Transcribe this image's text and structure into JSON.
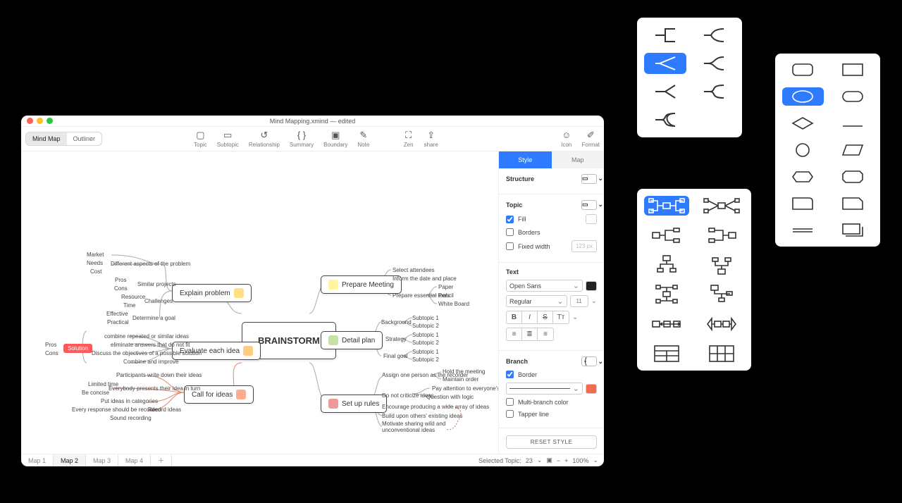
{
  "title": "Mind Mapping.xmind — edited",
  "views": {
    "mindmap": "Mind Map",
    "outliner": "Outliner"
  },
  "tools": {
    "topic": "Topic",
    "subtopic": "Subtopic",
    "relationship": "Relationship",
    "summary": "Summary",
    "boundary": "Boundary",
    "note": "Note",
    "zen": "Zen",
    "share": "share",
    "icon": "Icon",
    "format": "Format"
  },
  "mindmap": {
    "root": "BRAINSTORM",
    "explain": "Explain problem",
    "evaluate": "Evaluate each idea",
    "callfor": "Call for ideas",
    "prepare": "Prepare Meeting",
    "detail": "Detail plan",
    "setup": "Set up rules",
    "left": {
      "market": "Market",
      "needs": "Needs",
      "cost": "Cost",
      "diffaspects": "Different aspects of the problem",
      "pros": "Pros",
      "cons": "Cons",
      "resource": "Resource",
      "time": "Time",
      "similar": "Similar projects",
      "challenges": "Challenges",
      "effective": "Effective",
      "practical": "Practical",
      "determine": "Determine a goal",
      "combine": "combine repeated or similar ideas",
      "eliminate": "eliminate answers that do not fit",
      "discuss": "Discuss the objectives of a possible solution",
      "improve": "Combine and improve",
      "pros2": "Pros",
      "cons2": "Cons",
      "solution": "Solution",
      "limited": "Limited time",
      "concise": "Be concise",
      "participants": "Participants write down their ideas",
      "everybody": "Everybody presents their idea in turn",
      "putideas": "Put ideas in categories",
      "record": "Record ideas",
      "everyresp": "Every response should be recorded",
      "sound": "Sound recording"
    },
    "right": {
      "select": "Select attendees",
      "inform": "Inform the date and place",
      "prepess": "Prepare essential tools",
      "paper": "Paper",
      "pencil": "Pencil",
      "whiteboard": "White Board",
      "background": "Background",
      "strategy": "Strategy",
      "finalgoal": "Final goal",
      "sub1": "Subtopic 1",
      "sub2": "Subtopic 2",
      "sub1b": "Subtopic 1",
      "sub2b": "Subtopic 2",
      "sub1c": "Subtopic 1",
      "sub2c": "Subtopic 2",
      "assign": "Assign one person as the recorder",
      "holdmtg": "Hold the meeting",
      "maintain": "Maintain order",
      "donot": "Do not criticize ideas",
      "payatt": "Pay attention to everyone's ideas",
      "qlogic": "Question with logic",
      "encourage": "Encourage producing a wide array of ideas",
      "build": "Build upon others' existing ideas",
      "motivate": "Motivate sharing wild and unconventional ideas"
    }
  },
  "inspector": {
    "tabs": {
      "style": "Style",
      "map": "Map"
    },
    "structure": "Structure",
    "topic": "Topic",
    "fill": "Fill",
    "borders": "Borders",
    "fixedw": "Fixed width",
    "fixedw_ph": "123 px",
    "text": "Text",
    "font": "Open Sans",
    "weight": "Regular",
    "size": "11",
    "branch": "Branch",
    "border": "Border",
    "multib": "Multi-branch color",
    "tapper": "Tapper line",
    "reset": "RESET STYLE",
    "colors": {
      "text": "#222222",
      "stroke": "#f26b4e"
    }
  },
  "status": {
    "sheets": [
      "Map 1",
      "Map 2",
      "Map 3",
      "Map 4"
    ],
    "active": 1,
    "selected": "Selected Topic:",
    "count": "23",
    "zoom": "100%"
  }
}
